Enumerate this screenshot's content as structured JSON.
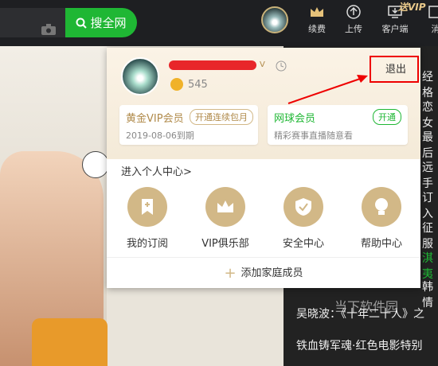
{
  "topbar": {
    "search_button": "搜全网",
    "nav": [
      {
        "label": "续费",
        "icon": "crown-icon"
      },
      {
        "label": "上传",
        "icon": "upload-icon"
      },
      {
        "label": "客户端",
        "icon": "download-icon"
      },
      {
        "label": "消",
        "icon": "more-icon"
      }
    ],
    "vip_corner": "送VIP"
  },
  "popup": {
    "points": "545",
    "logout": "退出",
    "gold_vip": {
      "title": "黄金VIP会员",
      "action": "开通连续包月",
      "expire": "2019-08-06到期"
    },
    "sports_vip": {
      "title": "网球会员",
      "action": "开通",
      "desc": "精彩赛事直播随意看"
    },
    "enter_center": "进入个人中心>",
    "features": [
      {
        "label": "我的订阅",
        "icon": "bookmark-plus-icon"
      },
      {
        "label": "VIP俱乐部",
        "icon": "crown-icon"
      },
      {
        "label": "安全中心",
        "icon": "shield-check-icon"
      },
      {
        "label": "帮助中心",
        "icon": "lightbulb-icon"
      }
    ],
    "add_family": "添加家庭成员"
  },
  "background": {
    "right_edge": [
      "经格",
      "恋女",
      "最后",
      "远手",
      "订入",
      "征服",
      "淇夷",
      "韩情"
    ],
    "bottom_lines": [
      "吴晓波：《十年二十人》之",
      "铁血铸军魂·红色电影特别"
    ],
    "watermark": "当下软件园"
  },
  "colors": {
    "brand_green": "#1fb734",
    "gold": "#d2b887",
    "green_text": "#1fb734",
    "red_annotation": "#e00000"
  }
}
